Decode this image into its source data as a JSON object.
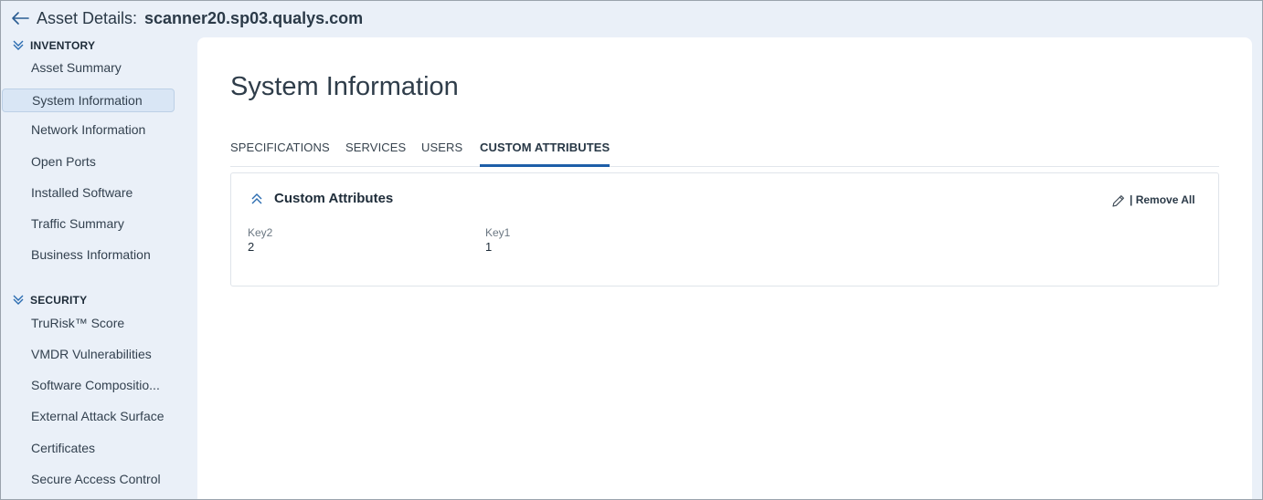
{
  "header": {
    "prefix": "Asset Details:",
    "hostname": "scanner20.sp03.qualys.com"
  },
  "sidebar": {
    "sections": [
      {
        "title": "INVENTORY",
        "items": [
          {
            "label": "Asset Summary"
          },
          {
            "label": "System Information",
            "active": true
          },
          {
            "label": "Network Information"
          },
          {
            "label": "Open Ports"
          },
          {
            "label": "Installed Software"
          },
          {
            "label": "Traffic Summary"
          },
          {
            "label": "Business Information"
          }
        ]
      },
      {
        "title": "SECURITY",
        "items": [
          {
            "label": "TruRisk™ Score"
          },
          {
            "label": "VMDR Vulnerabilities"
          },
          {
            "label": "Software Compositio..."
          },
          {
            "label": "External Attack Surface"
          },
          {
            "label": "Certificates"
          },
          {
            "label": "Secure Access Control"
          }
        ]
      }
    ]
  },
  "main": {
    "title": "System Information",
    "tabs": [
      {
        "label": "SPECIFICATIONS"
      },
      {
        "label": "SERVICES"
      },
      {
        "label": "USERS"
      },
      {
        "label": "CUSTOM ATTRIBUTES",
        "active": true
      }
    ],
    "card": {
      "title": "Custom Attributes",
      "remove_all": "| Remove All",
      "attributes": [
        {
          "key": "Key2",
          "value": "2"
        },
        {
          "key": "Key1",
          "value": "1"
        }
      ]
    }
  },
  "colors": {
    "accent": "#1d5ea8",
    "sidebar_bg": "#eaf0f8",
    "active_item_bg": "#d9e6f5"
  },
  "icons": {
    "back": "arrow-left-icon",
    "section_toggle": "double-chevron-down-icon",
    "card_toggle": "double-chevron-up-icon",
    "edit": "pencil-icon"
  }
}
